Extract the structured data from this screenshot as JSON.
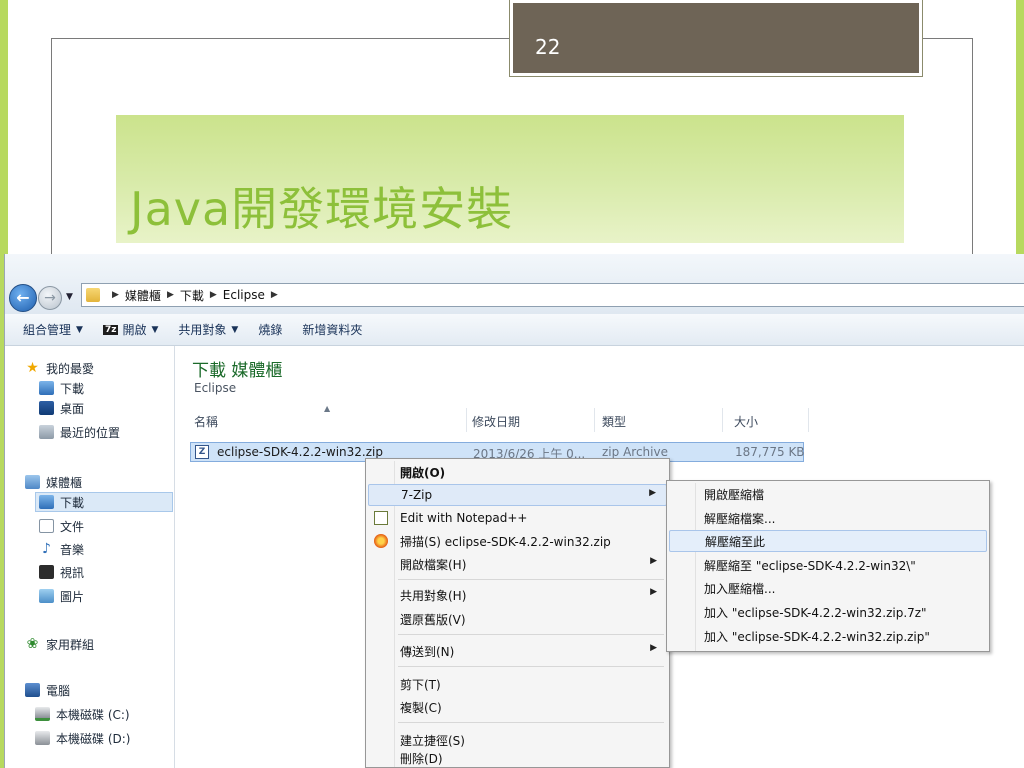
{
  "slide": {
    "number": "22",
    "title": "Java開發環境安裝"
  },
  "address": {
    "crumbs": [
      "媒體櫃",
      "下載",
      "Eclipse"
    ]
  },
  "toolbar": {
    "organize": "組合管理",
    "open": "開啟",
    "share": "共用對象",
    "burn": "燒錄",
    "new_folder": "新增資料夾"
  },
  "nav": {
    "favorites": "我的最愛",
    "downloads": "下載",
    "desktop": "桌面",
    "recent": "最近的位置",
    "libraries": "媒體櫃",
    "lib_downloads": "下載",
    "documents": "文件",
    "music": "音樂",
    "videos": "視訊",
    "pictures": "圖片",
    "homegroup": "家用群組",
    "computer": "電腦",
    "drive_c": "本機磁碟 (C:)",
    "drive_d": "本機磁碟 (D:)"
  },
  "content": {
    "library_title": "下載 媒體櫃",
    "library_sub": "Eclipse",
    "columns": {
      "name": "名稱",
      "modified": "修改日期",
      "type": "類型",
      "size": "大小"
    },
    "file": {
      "name": "eclipse-SDK-4.2.2-win32.zip",
      "modified": "2013/6/26 上午 0...",
      "type": "zip Archive",
      "size": "187,775 KB"
    }
  },
  "context_menu": {
    "open": "開啟(O)",
    "seven_zip": "7-Zip",
    "edit_npp": "Edit with Notepad++",
    "scan": "掃描(S) eclipse-SDK-4.2.2-win32.zip",
    "open_archive": "開啟檔案(H)",
    "share_with": "共用對象(H)",
    "restore": "還原舊版(V)",
    "send_to": "傳送到(N)",
    "cut": "剪下(T)",
    "copy": "複製(C)",
    "shortcut": "建立捷徑(S)",
    "delete": "刪除(D)"
  },
  "submenu": {
    "open_archive": "開啟壓縮檔",
    "extract_files": "解壓縮檔案...",
    "extract_here": "解壓縮至此",
    "extract_to": "解壓縮至 \"eclipse-SDK-4.2.2-win32\\\"",
    "add_archive": "加入壓縮檔...",
    "add_7z": "加入 \"eclipse-SDK-4.2.2-win32.zip.7z\"",
    "add_zip": "加入 \"eclipse-SDK-4.2.2-win32.zip.zip\""
  }
}
